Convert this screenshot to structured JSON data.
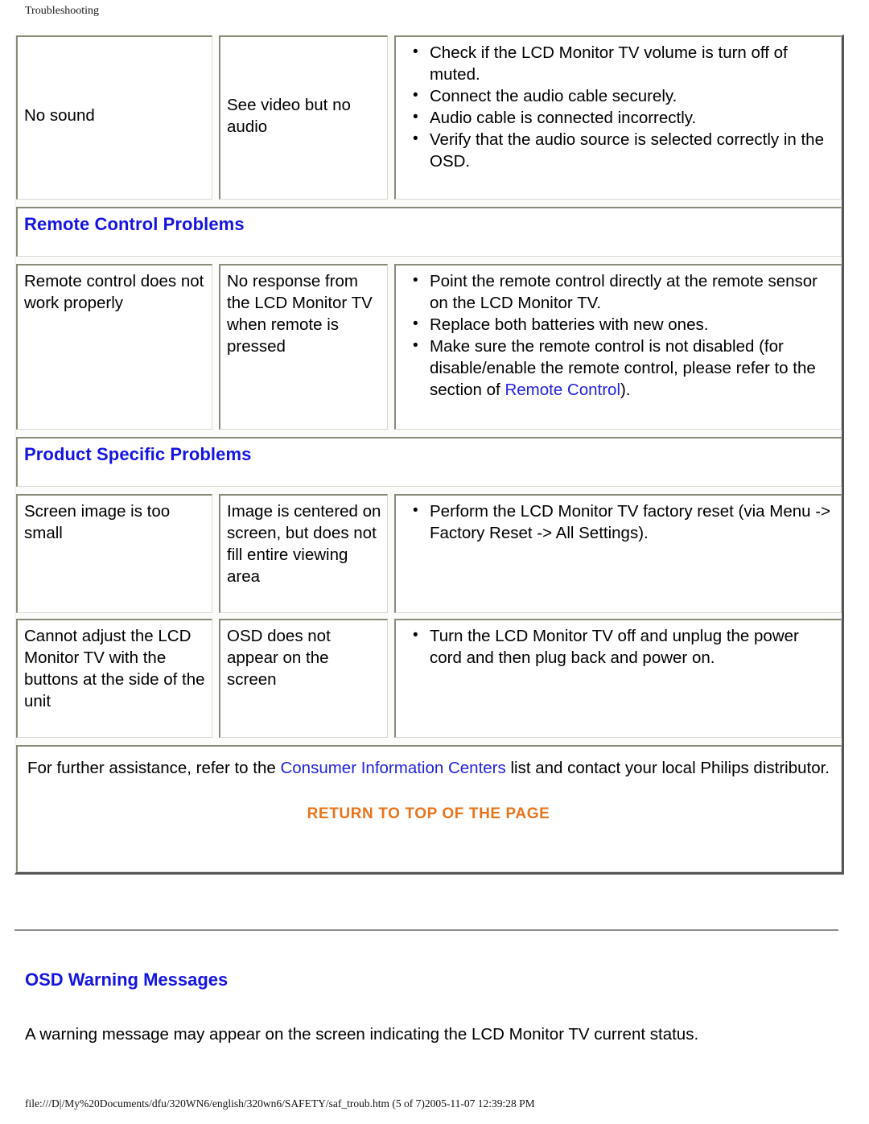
{
  "page": {
    "running_header": "Troubleshooting",
    "footer_path": "file:///D|/My%20Documents/dfu/320WN6/english/320wn6/SAFETY/saf_troub.htm (5 of 7)2005-11-07 12:39:28 PM"
  },
  "colors": {
    "heading_blue": "#1414e0",
    "link_blue": "#2222dd",
    "return_orange": "#e8741c",
    "cell_border": "#8a8a78",
    "table_border": "#555555"
  },
  "table": {
    "rows": [
      {
        "symptom": "No sound",
        "description": "See video but no audio",
        "solutions": [
          "Check if the LCD Monitor TV volume is turn off of muted.",
          "Connect the audio cable securely.",
          "Audio cable is connected incorrectly.",
          "Verify that the audio source is selected correctly in the OSD."
        ]
      }
    ],
    "section_remote": {
      "heading": "Remote Control Problems",
      "rows": [
        {
          "symptom": "Remote control does not work properly",
          "description": "No response from the LCD Monitor TV when remote is pressed",
          "solutions": [
            "Point the remote control directly at the remote sensor on the LCD Monitor TV.",
            "Replace both batteries with new ones."
          ],
          "last_solution": {
            "pre": "Make sure the remote control is not disabled (for disable/enable the remote control, please refer to the section of ",
            "link": "Remote Control",
            "post": ")."
          }
        }
      ]
    },
    "section_product": {
      "heading": "Product Specific Problems",
      "rows": [
        {
          "symptom": "Screen image is too small",
          "description": "Image is centered on screen, but does not fill entire viewing area",
          "solutions": [
            "Perform the LCD Monitor TV factory reset (via Menu -> Factory Reset -> All Settings)."
          ]
        },
        {
          "symptom": "Cannot adjust the LCD Monitor TV with the buttons at the side of the unit",
          "description": "OSD does not appear on the screen",
          "solutions": [
            "Turn the LCD Monitor TV off and unplug the power cord and then plug back and power on."
          ]
        }
      ]
    },
    "note": {
      "pre": "For further assistance, refer to the ",
      "link": "Consumer Information Centers",
      "post": " list and contact your local Philips distributor.",
      "return_to_top": "RETURN TO TOP OF THE PAGE"
    }
  },
  "osd_section": {
    "heading": "OSD Warning Messages",
    "body": "A warning message may appear on the screen indicating the LCD Monitor TV current status."
  }
}
